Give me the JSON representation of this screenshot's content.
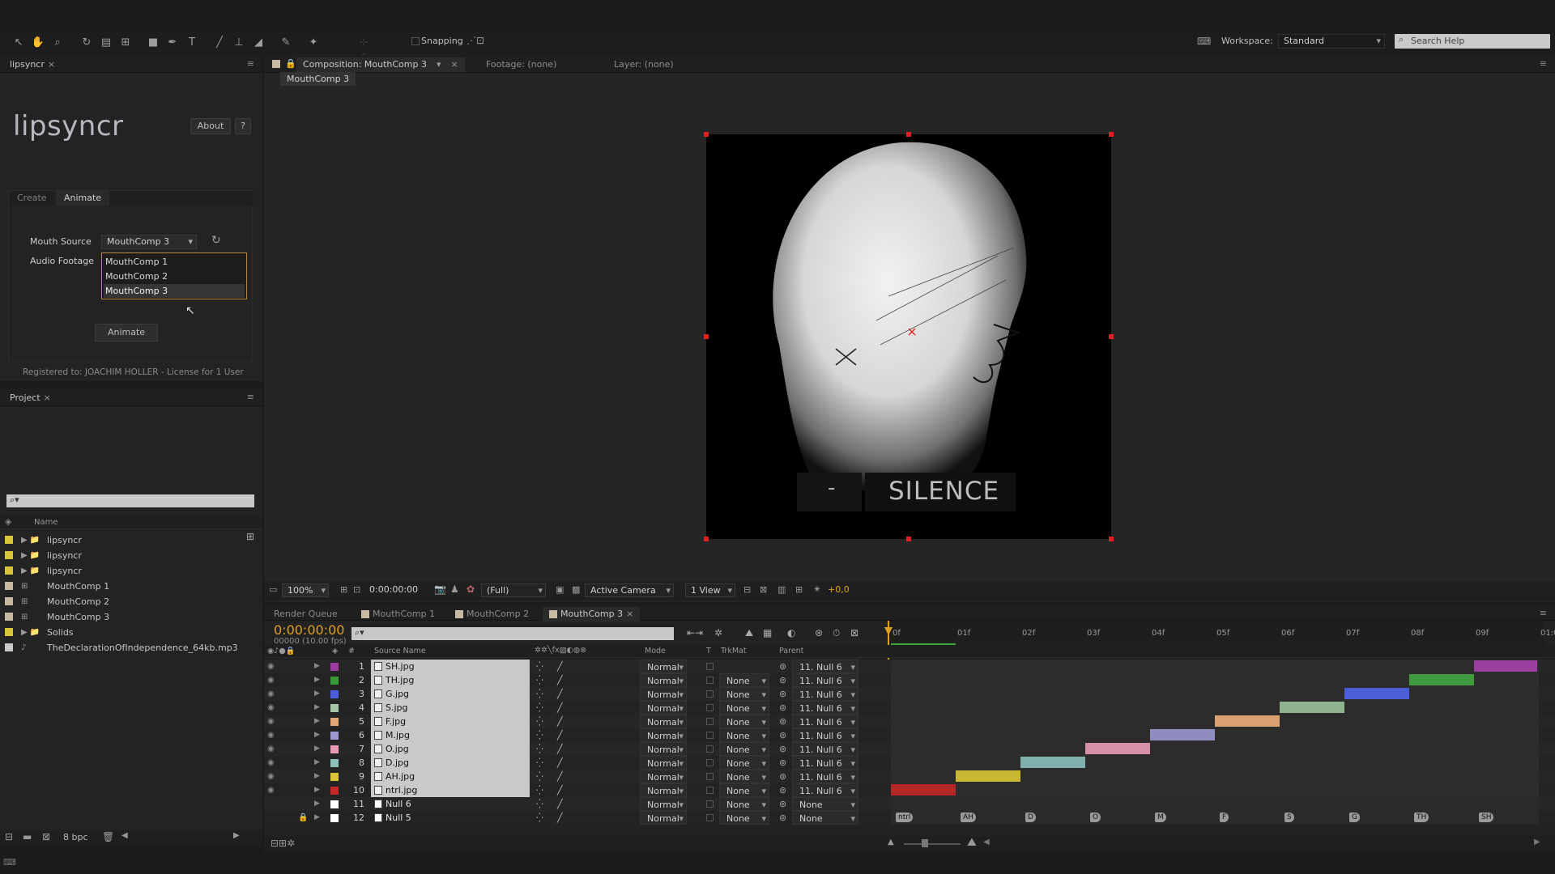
{
  "toolbar": {
    "snapping_label": "Snapping",
    "workspace_label": "Workspace:",
    "workspace_value": "Standard",
    "search_placeholder": "Search Help"
  },
  "lipsyncr": {
    "tab_title": "lipsyncr",
    "logo_text": "lipsyncr",
    "about_label": "About",
    "help_label": "?",
    "tabs": [
      "Create",
      "Animate"
    ],
    "mouth_source_label": "Mouth Source",
    "mouth_source_value": "MouthComp 3",
    "audio_footage_label": "Audio Footage",
    "dropdown_options": [
      "MouthComp 1",
      "MouthComp 2",
      "MouthComp 3"
    ],
    "animate_button": "Animate",
    "registration": "Registered to: JOACHIM HOLLER - License for 1 User"
  },
  "project": {
    "tab_title": "Project",
    "search_placeholder": "⌕▾",
    "name_header": "Name",
    "items": [
      {
        "name": "lipsyncr",
        "type": "folder",
        "color": "#d8c53a"
      },
      {
        "name": "lipsyncr",
        "type": "folder",
        "color": "#d8c53a"
      },
      {
        "name": "lipsyncr",
        "type": "folder",
        "color": "#d8c53a"
      },
      {
        "name": "MouthComp 1",
        "type": "comp",
        "color": "#c8b9a2"
      },
      {
        "name": "MouthComp 2",
        "type": "comp",
        "color": "#c8b9a2"
      },
      {
        "name": "MouthComp 3",
        "type": "comp",
        "color": "#c8b9a2"
      },
      {
        "name": "Solids",
        "type": "folder",
        "color": "#d8c53a"
      },
      {
        "name": "TheDeclarationOfIndependence_64kb.mp3",
        "type": "audio",
        "color": "#c8c8c8"
      }
    ],
    "bpc_label": "8 bpc"
  },
  "composition": {
    "tab_title": "Composition: MouthComp 3",
    "footage_label": "Footage: (none)",
    "layer_label": "Layer: (none)",
    "breadcrumb": "MouthComp 3",
    "viewer_text_left": "-",
    "viewer_text_right": "SILENCE",
    "zoom": "100%",
    "timecode": "0:00:00:00",
    "resolution": "(Full)",
    "camera": "Active Camera",
    "view": "1 View",
    "exposure": "+0,0"
  },
  "timeline": {
    "tabs": [
      "Render Queue",
      "MouthComp 1",
      "MouthComp 2",
      "MouthComp 3"
    ],
    "timecode": "0:00:00:00",
    "frame_info": "00000 (10.00 fps)",
    "headers": {
      "num": "#",
      "source": "Source Name",
      "mode": "Mode",
      "t": "T",
      "trkmat": "TrkMat",
      "parent": "Parent"
    },
    "ruler": [
      "0f",
      "01f",
      "02f",
      "03f",
      "04f",
      "05f",
      "06f",
      "07f",
      "08f",
      "09f",
      "01:0"
    ],
    "layers": [
      {
        "num": "1",
        "name": "SH.jpg",
        "color": "#9b3ea0",
        "mode": "Normal",
        "trkmat": "",
        "parent": "11. Null 6",
        "bar_start": 9,
        "bar_color": "#9b3ea0"
      },
      {
        "num": "2",
        "name": "TH.jpg",
        "color": "#3a9a3a",
        "mode": "Normal",
        "trkmat": "None",
        "parent": "11. Null 6",
        "bar_start": 8,
        "bar_color": "#3e9a3e"
      },
      {
        "num": "3",
        "name": "G.jpg",
        "color": "#4a5fd8",
        "mode": "Normal",
        "trkmat": "None",
        "parent": "11. Null 6",
        "bar_start": 7,
        "bar_color": "#4a5fd8"
      },
      {
        "num": "4",
        "name": "S.jpg",
        "color": "#a8c4a8",
        "mode": "Normal",
        "trkmat": "None",
        "parent": "11. Null 6",
        "bar_start": 6,
        "bar_color": "#8fb38f"
      },
      {
        "num": "5",
        "name": "F.jpg",
        "color": "#e2a878",
        "mode": "Normal",
        "trkmat": "None",
        "parent": "11. Null 6",
        "bar_start": 5,
        "bar_color": "#d9a070"
      },
      {
        "num": "6",
        "name": "M.jpg",
        "color": "#9a98cc",
        "mode": "Normal",
        "trkmat": "None",
        "parent": "11. Null 6",
        "bar_start": 4,
        "bar_color": "#8e8cc0"
      },
      {
        "num": "7",
        "name": "O.jpg",
        "color": "#e79ab5",
        "mode": "Normal",
        "trkmat": "None",
        "parent": "11. Null 6",
        "bar_start": 3,
        "bar_color": "#d890a8"
      },
      {
        "num": "8",
        "name": "D.jpg",
        "color": "#8fbfbc",
        "mode": "Normal",
        "trkmat": "None",
        "parent": "11. Null 6",
        "bar_start": 2,
        "bar_color": "#7fb0ad"
      },
      {
        "num": "9",
        "name": "AH.jpg",
        "color": "#d8c53a",
        "mode": "Normal",
        "trkmat": "None",
        "parent": "11. Null 6",
        "bar_start": 1,
        "bar_color": "#c9b632"
      },
      {
        "num": "10",
        "name": "ntrl.jpg",
        "color": "#c42a2a",
        "mode": "Normal",
        "trkmat": "None",
        "parent": "11. Null 6",
        "bar_start": 0,
        "bar_color": "#b42626"
      },
      {
        "num": "11",
        "name": "Null 6",
        "color": "#ffffff",
        "mode": "Normal",
        "trkmat": "None",
        "parent": "None",
        "bar_start": -1,
        "bar_color": ""
      },
      {
        "num": "12",
        "name": "Null 5",
        "color": "#ffffff",
        "mode": "Normal",
        "trkmat": "None",
        "parent": "None",
        "bar_start": -1,
        "bar_color": ""
      }
    ],
    "markers": [
      "ntrl",
      "AH",
      "D",
      "O",
      "M",
      "F",
      "S",
      "G",
      "TH",
      "SH"
    ]
  },
  "colors": {
    "accent_time": "#e0a020",
    "selection_handle": "#e02020"
  }
}
